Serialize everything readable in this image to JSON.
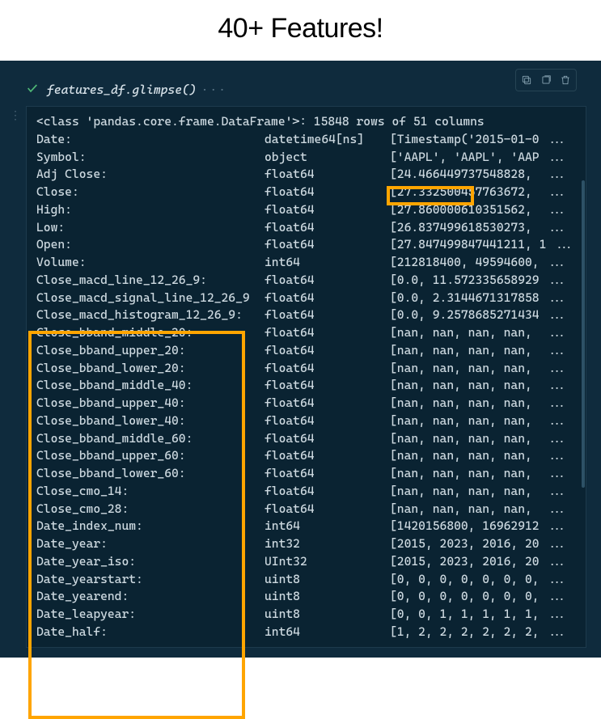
{
  "title": "40+ Features!",
  "command": "features_df.glimpse()",
  "class_line": "<class 'pandas.core.frame.DataFrame'>: 15848 rows of 51 columns",
  "rows": [
    {
      "name": "Date:",
      "dtype": "datetime64[ns]",
      "values": "[Timestamp('2015-01-0 ..."
    },
    {
      "name": "Symbol:",
      "dtype": "object",
      "values": "['AAPL', 'AAPL', 'AAP ..."
    },
    {
      "name": "Adj Close:",
      "dtype": "float64",
      "values": "[24.466449737548828,  ..."
    },
    {
      "name": "Close:",
      "dtype": "float64",
      "values": "[27.332500457763672,  ..."
    },
    {
      "name": "High:",
      "dtype": "float64",
      "values": "[27.860000610351562,  ..."
    },
    {
      "name": "Low:",
      "dtype": "float64",
      "values": "[26.837499618530273,  ..."
    },
    {
      "name": "Open:",
      "dtype": "float64",
      "values": "[27.847499847441211, 1 ..."
    },
    {
      "name": "Volume:",
      "dtype": "int64",
      "values": "[212818400, 49594600, ..."
    },
    {
      "name": "Close_macd_line_12_26_9:",
      "dtype": "float64",
      "values": "[0.0, 11.572335658929 ..."
    },
    {
      "name": "Close_macd_signal_line_12_26_9",
      "dtype": "float64",
      "values": "[0.0, 2.3144671317858 ..."
    },
    {
      "name": "Close_macd_histogram_12_26_9:",
      "dtype": "float64",
      "values": "[0.0, 9.2578685271434 ..."
    },
    {
      "name": "Close_bband_middle_20:",
      "dtype": "float64",
      "values": "[nan, nan, nan, nan,  ..."
    },
    {
      "name": "Close_bband_upper_20:",
      "dtype": "float64",
      "values": "[nan, nan, nan, nan,  ..."
    },
    {
      "name": "Close_bband_lower_20:",
      "dtype": "float64",
      "values": "[nan, nan, nan, nan,  ..."
    },
    {
      "name": "Close_bband_middle_40:",
      "dtype": "float64",
      "values": "[nan, nan, nan, nan,  ..."
    },
    {
      "name": "Close_bband_upper_40:",
      "dtype": "float64",
      "values": "[nan, nan, nan, nan,  ..."
    },
    {
      "name": "Close_bband_lower_40:",
      "dtype": "float64",
      "values": "[nan, nan, nan, nan,  ..."
    },
    {
      "name": "Close_bband_middle_60:",
      "dtype": "float64",
      "values": "[nan, nan, nan, nan,  ..."
    },
    {
      "name": "Close_bband_upper_60:",
      "dtype": "float64",
      "values": "[nan, nan, nan, nan,  ..."
    },
    {
      "name": "Close_bband_lower_60:",
      "dtype": "float64",
      "values": "[nan, nan, nan, nan,  ..."
    },
    {
      "name": "Close_cmo_14:",
      "dtype": "float64",
      "values": "[nan, nan, nan, nan,  ..."
    },
    {
      "name": "Close_cmo_28:",
      "dtype": "float64",
      "values": "[nan, nan, nan, nan,  ..."
    },
    {
      "name": "Date_index_num:",
      "dtype": "int64",
      "values": "[1420156800, 16962912 ..."
    },
    {
      "name": "Date_year:",
      "dtype": "int32",
      "values": "[2015, 2023, 2016, 20 ..."
    },
    {
      "name": "Date_year_iso:",
      "dtype": "UInt32",
      "values": "[2015, 2023, 2016, 20 ..."
    },
    {
      "name": "Date_yearstart:",
      "dtype": "uint8",
      "values": "[0, 0, 0, 0, 0, 0, 0, ..."
    },
    {
      "name": "Date_yearend:",
      "dtype": "uint8",
      "values": "[0, 0, 0, 0, 0, 0, 0, ..."
    },
    {
      "name": "Date_leapyear:",
      "dtype": "uint8",
      "values": "[0, 0, 1, 1, 1, 1, 1, ..."
    },
    {
      "name": "Date_half:",
      "dtype": "int64",
      "values": "[1, 2, 2, 2, 2, 2, 2, ..."
    }
  ]
}
